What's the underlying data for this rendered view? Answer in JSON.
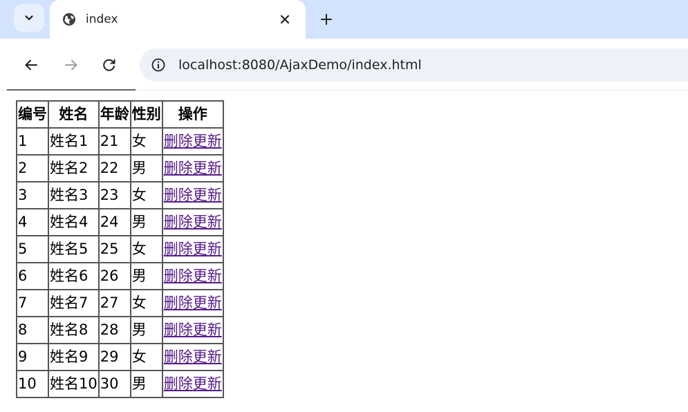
{
  "browser": {
    "tab_title": "index",
    "url": "localhost:8080/AjaxDemo/index.html",
    "icons": {
      "tab_search": "chevron-down-icon",
      "tab_favicon": "globe-icon",
      "tab_close": "close-icon",
      "new_tab": "plus-icon",
      "back": "back-arrow-icon",
      "forward": "forward-arrow-icon",
      "reload": "reload-icon",
      "site_info": "info-icon"
    },
    "colors": {
      "tabstrip": "#d3e3fd",
      "omnibox": "#eef2f8",
      "visited_link": "#551a8b"
    }
  },
  "table": {
    "headers": [
      "编号",
      "姓名",
      "年龄",
      "性别",
      "操作"
    ],
    "rows": [
      {
        "id": "1",
        "name": "姓名1",
        "age": "21",
        "gender": "女",
        "delete": "删除",
        "update": "更新"
      },
      {
        "id": "2",
        "name": "姓名2",
        "age": "22",
        "gender": "男",
        "delete": "删除",
        "update": "更新"
      },
      {
        "id": "3",
        "name": "姓名3",
        "age": "23",
        "gender": "女",
        "delete": "删除",
        "update": "更新"
      },
      {
        "id": "4",
        "name": "姓名4",
        "age": "24",
        "gender": "男",
        "delete": "删除",
        "update": "更新"
      },
      {
        "id": "5",
        "name": "姓名5",
        "age": "25",
        "gender": "女",
        "delete": "删除",
        "update": "更新"
      },
      {
        "id": "6",
        "name": "姓名6",
        "age": "26",
        "gender": "男",
        "delete": "删除",
        "update": "更新"
      },
      {
        "id": "7",
        "name": "姓名7",
        "age": "27",
        "gender": "女",
        "delete": "删除",
        "update": "更新"
      },
      {
        "id": "8",
        "name": "姓名8",
        "age": "28",
        "gender": "男",
        "delete": "删除",
        "update": "更新"
      },
      {
        "id": "9",
        "name": "姓名9",
        "age": "29",
        "gender": "女",
        "delete": "删除",
        "update": "更新"
      },
      {
        "id": "10",
        "name": "姓名10",
        "age": "30",
        "gender": "男",
        "delete": "删除",
        "update": "更新"
      }
    ]
  }
}
